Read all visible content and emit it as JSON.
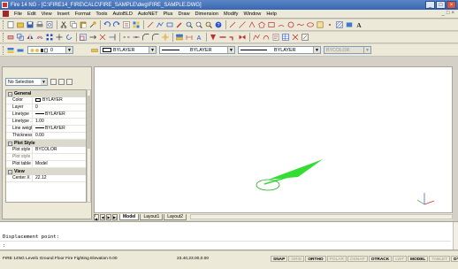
{
  "window": {
    "title": "Fire 14 NG - [C:\\FIRE14_FIRE\\CALC\\FIRE_SAMPLE\\dwg\\FIRE_SAMPLE.DWG]",
    "controls": [
      "_",
      "□",
      "×"
    ]
  },
  "menubar": {
    "items": [
      "File",
      "Edit",
      "View",
      "Insert",
      "Format",
      "Tools",
      "AutoBLD",
      "AutoNET",
      "Plus",
      "Draw",
      "Dimension",
      "Modify",
      "Window",
      "Help"
    ],
    "mdi_controls": [
      "_",
      "□",
      "×"
    ]
  },
  "layer_toolbar": {
    "layer_value": "0",
    "color_value": "BYLAYER",
    "linetype_value": "BYLAYER",
    "lineweight_value": "BYLAYER",
    "plotstyle_value": "BYCOLOR"
  },
  "properties": {
    "selection_value": "No Selection",
    "categories": [
      {
        "name": "General",
        "rows": [
          {
            "name": "Color",
            "value": "BYLAYER",
            "kind": "swatch"
          },
          {
            "name": "Layer",
            "value": "0"
          },
          {
            "name": "Linetype",
            "value": "BYLAYER",
            "kind": "line"
          },
          {
            "name": "Linetype ...",
            "value": "1.00"
          },
          {
            "name": "Line weight",
            "value": "BYLAYER",
            "kind": "line"
          },
          {
            "name": "Thickness",
            "value": "0.00"
          }
        ]
      },
      {
        "name": "Plot Style",
        "rows": [
          {
            "name": "Plot style",
            "value": "BYCOLOR"
          },
          {
            "name": "Plot style ...",
            "value": "",
            "gray": true
          },
          {
            "name": "Plot table ...",
            "value": "Model"
          }
        ]
      },
      {
        "name": "View",
        "rows": [
          {
            "name": "Center X",
            "value": "22.12"
          }
        ]
      }
    ]
  },
  "layout_tabs": [
    "Model",
    "Layout1",
    "Layout2"
  ],
  "command": {
    "line1": "Displacement point:",
    "line2": ":"
  },
  "status": {
    "message": "FIRE 14NG Level1 Ground Floor Fire Fighting Elevation 0.00",
    "coords": "23.40,23.00,0.00",
    "toggles": [
      {
        "label": "SNAP",
        "on": true
      },
      {
        "label": "GRID",
        "on": false
      },
      {
        "label": "ORTHO",
        "on": true
      },
      {
        "label": "POLAR",
        "on": false
      },
      {
        "label": "OSNAP",
        "on": false
      },
      {
        "label": "OTRACK",
        "on": true
      },
      {
        "label": "LWT",
        "on": false
      },
      {
        "label": "MODEL",
        "on": true
      },
      {
        "label": "TABLET",
        "on": false
      },
      {
        "label": "DYN",
        "on": true
      }
    ]
  },
  "colors": {
    "arrow": "#33dd33",
    "circle": "#22aa22",
    "ucs_x": "#d03030",
    "ucs_y": "#2a9a2a",
    "ucs_z": "#2a4fd0"
  }
}
